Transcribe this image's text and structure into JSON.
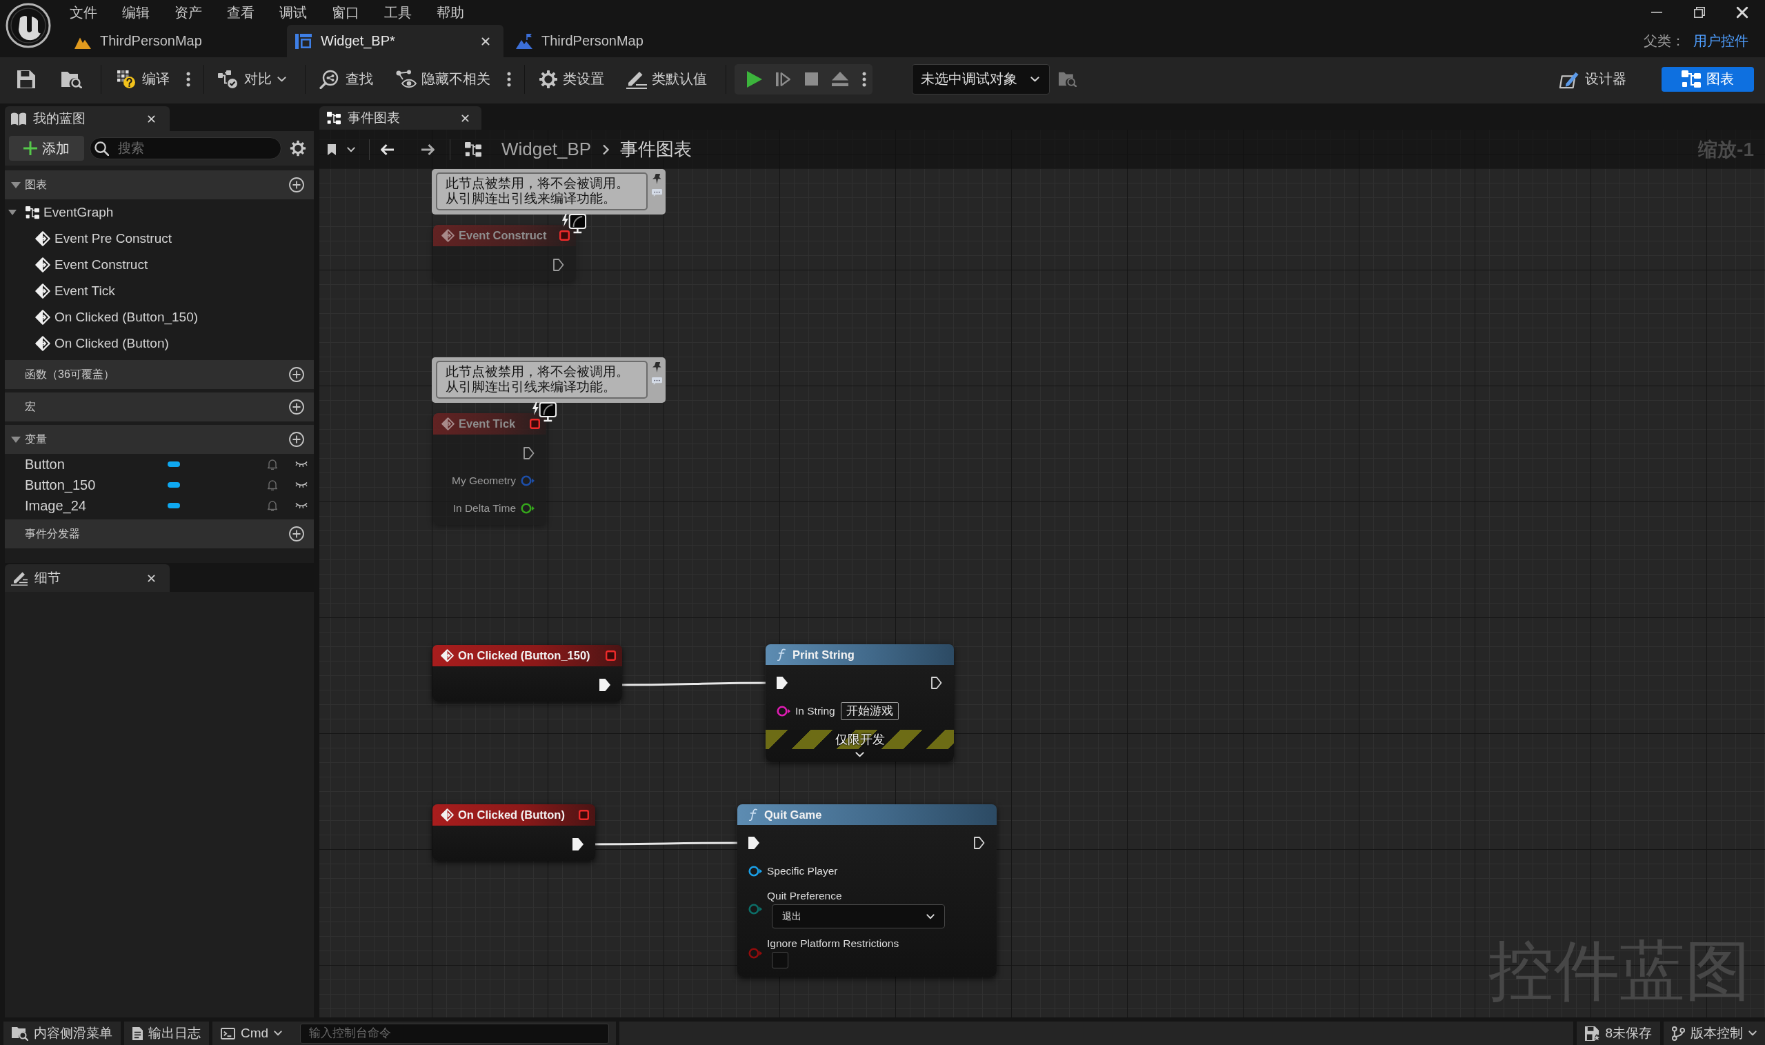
{
  "menu_bar": {
    "items": [
      "文件",
      "编辑",
      "资产",
      "查看",
      "调试",
      "窗口",
      "工具",
      "帮助"
    ]
  },
  "document_tabs": [
    {
      "label": "ThirdPersonMap",
      "kind": "level",
      "selected": false
    },
    {
      "label": "Widget_BP*",
      "kind": "widget",
      "selected": true
    },
    {
      "label": "ThirdPersonMap",
      "kind": "map",
      "selected": false
    }
  ],
  "parent_class": {
    "label": "父类：",
    "value": "用户控件"
  },
  "toolbar": {
    "buttons": [
      {
        "label": "编译",
        "kind": "compile"
      },
      {
        "label": "对比",
        "kind": "diff"
      },
      {
        "label": "查找",
        "kind": "find"
      },
      {
        "label": "隐藏不相关",
        "kind": "hide_unrelated"
      },
      {
        "label": "类设置",
        "kind": "class_settings"
      },
      {
        "label": "类默认值",
        "kind": "class_defaults"
      }
    ],
    "debug_filter": {
      "value": "未选中调试对象"
    },
    "modes": [
      {
        "label": "设计器",
        "kind": "designer",
        "selected": false
      },
      {
        "label": "图表",
        "kind": "graph",
        "selected": true
      }
    ]
  },
  "my_blueprint": {
    "tab": "我的蓝图",
    "add_button": "添加",
    "search": {
      "placeholder": "搜索"
    },
    "sections": [
      {
        "label": "图表",
        "expanded": true,
        "items": [
          {
            "label": "EventGraph",
            "kind": "graph",
            "expanded": true,
            "children": [
              {
                "label": "Event Pre Construct",
                "kind": "event"
              },
              {
                "label": "Event Construct",
                "kind": "event"
              },
              {
                "label": "Event Tick",
                "kind": "event"
              },
              {
                "label": "On Clicked (Button_150)",
                "kind": "event"
              },
              {
                "label": "On Clicked (Button)",
                "kind": "event"
              }
            ]
          }
        ]
      },
      {
        "label": "函数（36可覆盖）"
      },
      {
        "label": "宏"
      },
      {
        "label": "变量",
        "expanded": true,
        "variables": [
          {
            "name": "Button"
          },
          {
            "name": "Button_150"
          },
          {
            "name": "Image_24"
          }
        ]
      },
      {
        "label": "事件分发器"
      }
    ]
  },
  "details": {
    "tab": "细节"
  },
  "graph": {
    "tab": "事件图表",
    "breadcrumb": [
      "Widget_BP",
      "事件图表"
    ],
    "zoom": "缩放-1",
    "graph_type": "控件蓝图",
    "nodes": [
      {
        "kind": "event",
        "title": "Event Construct",
        "disabled": true,
        "comment": [
          "此节点被禁用，将不会被调用。",
          "从引脚连出引线来编译功能。"
        ],
        "pins": [
          {
            "kind": "exec_out",
            "connected": false
          }
        ]
      },
      {
        "kind": "event",
        "title": "Event Tick",
        "disabled": true,
        "comment": [
          "此节点被禁用，将不会被调用。",
          "从引脚连出引线来编译功能。"
        ],
        "pins": [
          {
            "kind": "exec_out",
            "connected": false
          },
          {
            "kind": "data_out",
            "label": "My Geometry",
            "color": "#1d4ea8",
            "connected": false
          },
          {
            "kind": "data_out",
            "label": "In Delta Time",
            "color": "#35a51c",
            "connected": false
          }
        ]
      },
      {
        "kind": "event",
        "title": "On Clicked (Button_150)",
        "disabled": false,
        "pins": [
          {
            "kind": "exec_out",
            "connected": true
          }
        ]
      },
      {
        "kind": "function",
        "title": "Print String",
        "disabled": false,
        "pins": [
          {
            "kind": "exec_in",
            "connected": true
          },
          {
            "kind": "exec_out",
            "connected": false
          },
          {
            "kind": "string",
            "label": "In String",
            "color": "#e01cb4",
            "connected": false,
            "value": "开始游戏"
          }
        ],
        "banner": "仅限开发"
      },
      {
        "kind": "event",
        "title": "On Clicked (Button)",
        "disabled": false,
        "pins": [
          {
            "kind": "exec_out",
            "connected": true
          }
        ]
      },
      {
        "kind": "function",
        "title": "Quit Game",
        "disabled": false,
        "pins": [
          {
            "kind": "exec_in",
            "connected": true
          },
          {
            "kind": "exec_out",
            "connected": false
          },
          {
            "kind": "data_in",
            "label": "Specific Player",
            "color": "#1aa0e8",
            "connected": false
          },
          {
            "kind": "enum",
            "label": "Quit Preference",
            "color": "#0c6e68",
            "connected": false,
            "value": "退出"
          },
          {
            "kind": "bool",
            "label": "Ignore Platform Restrictions",
            "color": "#920c0c",
            "connected": false,
            "checked": false
          }
        ]
      }
    ]
  },
  "status_bar": {
    "left": [
      {
        "label": "内容侧滑菜单",
        "kind": "drawer"
      },
      {
        "label": "输出日志",
        "kind": "log"
      },
      {
        "label": "Cmd",
        "kind": "cmd"
      }
    ],
    "console": {
      "placeholder": "输入控制台命令"
    },
    "right": [
      {
        "label": "8未保存",
        "kind": "save"
      },
      {
        "label": "版本控制",
        "kind": "source_control"
      }
    ]
  }
}
